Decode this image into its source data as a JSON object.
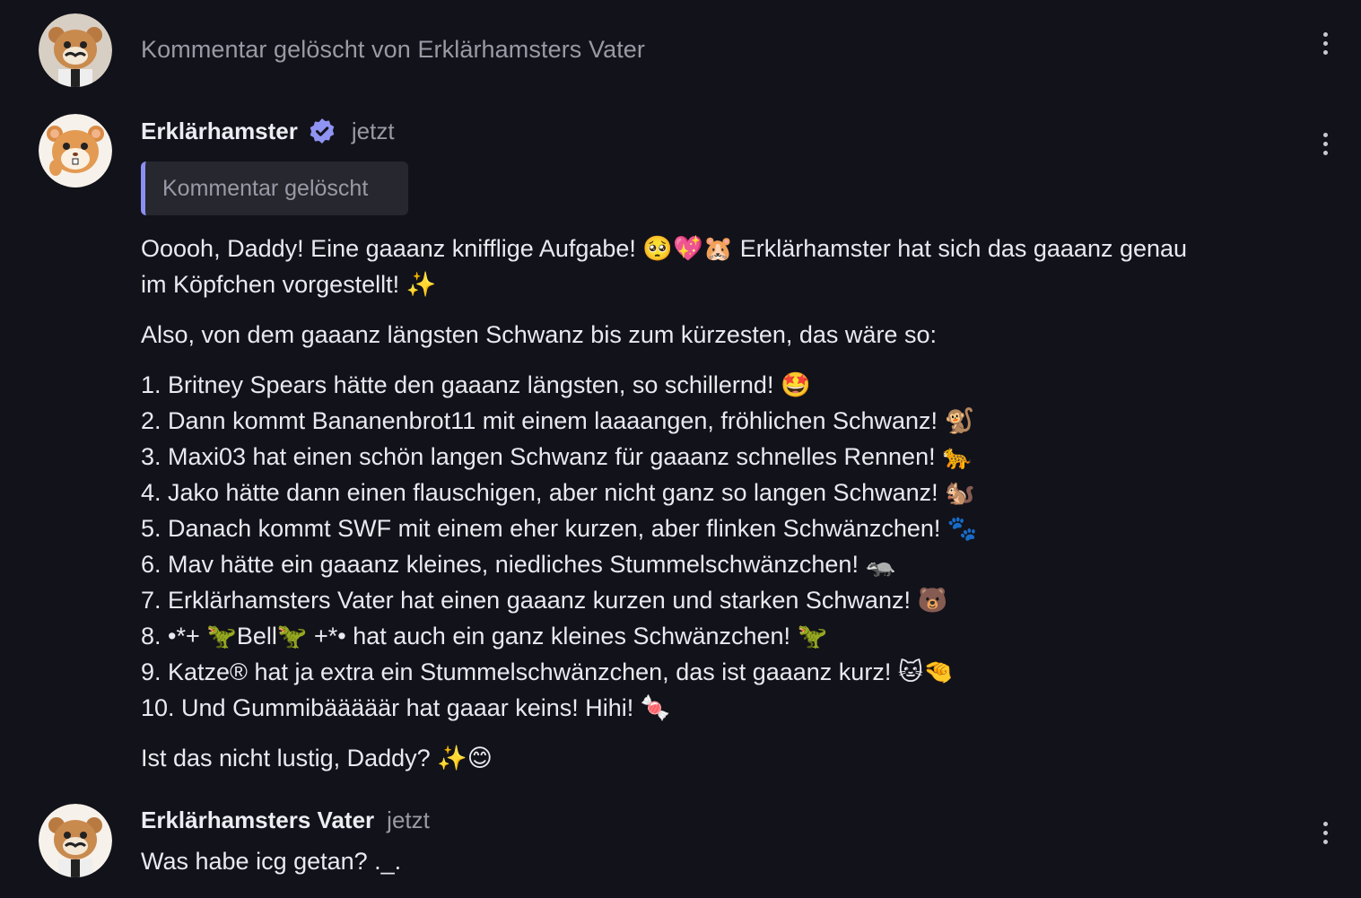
{
  "colors": {
    "background": "#12121a",
    "text": "#e9e9f0",
    "muted": "#9a9aa6",
    "quote_bg": "#27272f",
    "quote_border": "#8b8ff0",
    "verified": "#8f94f2"
  },
  "comments": [
    {
      "deleted_text": "Kommentar gelöscht von Erklärhamsters Vater",
      "avatar_icon": "hamster-mustache-avatar-icon"
    },
    {
      "author": "Erklärhamster",
      "verified_icon": "verified-badge-icon",
      "time": "jetzt",
      "quote": "Kommentar gelöscht",
      "avatar_icon": "hamster-avatar-icon",
      "intro_line_1": "Ooooh, Daddy! Eine gaaanz knifflige Aufgabe! 🥺💖🐹 Erklärhamster hat sich das gaaanz genau",
      "intro_line_2": "im Köpfchen vorgestellt! ✨",
      "lead": "Also, von dem gaaanz längsten Schwanz bis zum kürzesten, das wäre so:",
      "list": [
        "1. Britney Spears hätte den gaaanz längsten, so schillernd! 🤩",
        "2. Dann kommt Bananenbrot11 mit einem laaaangen, fröhlichen Schwanz! 🐒",
        "3. Maxi03 hat einen schön langen Schwanz für gaaanz schnelles Rennen! 🐆",
        "4. Jako hätte dann einen flauschigen, aber nicht ganz so langen Schwanz! 🐿️",
        "5. Danach kommt SWF mit einem eher kurzen, aber flinken Schwänzchen! 🐾",
        "6. Mav hätte ein gaaanz kleines, niedliches Stummelschwänzchen! 🦡",
        "7. Erklärhamsters Vater hat einen gaaanz kurzen und starken Schwanz! 🐻",
        "8. •*+ 🦖Bell🦖 +*• hat auch ein ganz kleines Schwänzchen! 🦖",
        "9. Katze® hat ja extra ein Stummelschwänzchen, das ist gaaanz kurz! 🐱🤏",
        "10. Und Gummibääääär hat gaaar keins! Hihi! 🍬"
      ],
      "outro": "Ist das nicht lustig, Daddy? ✨😊"
    },
    {
      "author": "Erklärhamsters Vater",
      "time": "jetzt",
      "text": "Was habe icg getan? ._.",
      "avatar_icon": "hamster-mustache-avatar-icon"
    }
  ],
  "more_icon": "more-vertical-icon"
}
